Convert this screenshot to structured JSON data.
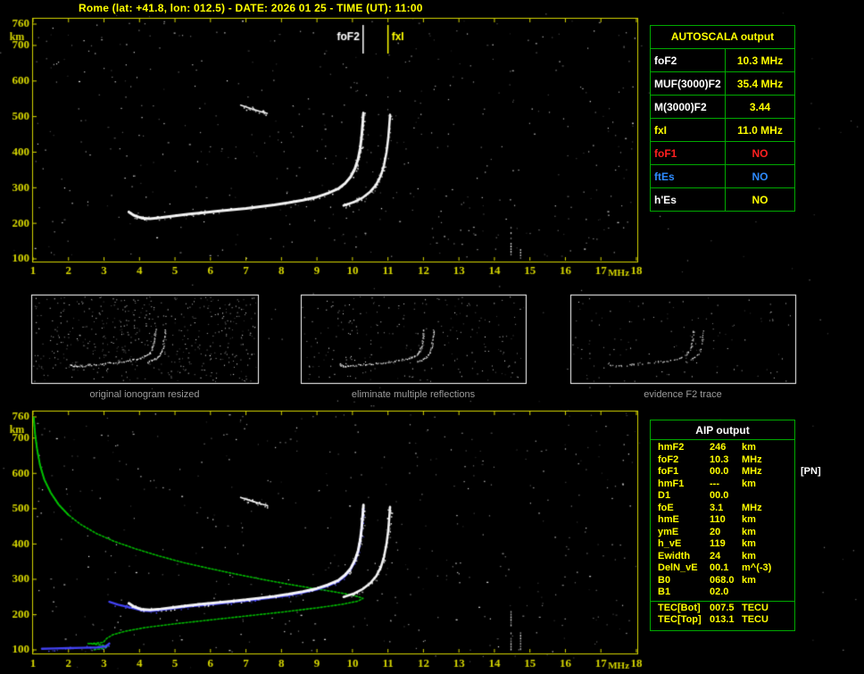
{
  "title": "Rome (lat: +41.8, lon: 012.5) - DATE: 2026 01 25 - TIME (UT): 11:00",
  "colors": {
    "background": "#000000",
    "axis": "#d6d600",
    "trace": "#ffffff",
    "profile": "#00c000",
    "restored": "#4646ff",
    "table_border": "#00aa00",
    "caption": "#9c9c9c"
  },
  "autoscala_table": {
    "header": "AUTOSCALA output",
    "rows": [
      {
        "label": "foF2",
        "value": "10.3 MHz",
        "label_color": "#ffffff",
        "value_color": "#ffff00"
      },
      {
        "label": "MUF(3000)F2",
        "value": "35.4 MHz",
        "label_color": "#ffffff",
        "value_color": "#ffff00"
      },
      {
        "label": "M(3000)F2",
        "value": "3.44",
        "label_color": "#ffffff",
        "value_color": "#ffff00"
      },
      {
        "label": "fxI",
        "value": "11.0 MHz",
        "label_color": "#ffff00",
        "value_color": "#ffff00"
      },
      {
        "label": "foF1",
        "value": "NO",
        "label_color": "#ff2020",
        "value_color": "#ff2020"
      },
      {
        "label": "ftEs",
        "value": "NO",
        "label_color": "#2e8bff",
        "value_color": "#2e8bff"
      },
      {
        "label": "h'Es",
        "value": "NO",
        "label_color": "#ffffff",
        "value_color": "#ffff00"
      }
    ]
  },
  "aip_table": {
    "header": "AIP output",
    "rows": [
      {
        "name": "hmF2",
        "value": "246",
        "unit": "km"
      },
      {
        "name": "foF2",
        "value": "10.3",
        "unit": "MHz"
      },
      {
        "name": "foF1",
        "value": "00.0",
        "unit": "MHz",
        "note": "[PN]"
      },
      {
        "name": "hmF1",
        "value": "---",
        "unit": "km"
      },
      {
        "name": "D1",
        "value": "00.0",
        "unit": ""
      },
      {
        "name": "foE",
        "value": "3.1",
        "unit": "MHz"
      },
      {
        "name": "hmE",
        "value": "110",
        "unit": "km"
      },
      {
        "name": "ymE",
        "value": "20",
        "unit": "km"
      },
      {
        "name": "h_vE",
        "value": "119",
        "unit": "km"
      },
      {
        "name": "Ewidth",
        "value": "24",
        "unit": "km"
      },
      {
        "name": "DelN_vE",
        "value": "00.1",
        "unit": "m^(-3)"
      },
      {
        "name": "B0",
        "value": "068.0",
        "unit": "km"
      },
      {
        "name": "B1",
        "value": "02.0",
        "unit": ""
      }
    ],
    "tec_rows": [
      {
        "name": "TEC[Bot]",
        "value": "007.5",
        "unit": "TECU"
      },
      {
        "name": "TEC[Top]",
        "value": "013.1",
        "unit": "TECU"
      }
    ]
  },
  "thumbnails": [
    {
      "caption": "original ionogram resized",
      "noise": 520
    },
    {
      "caption": "eliminate multiple reflections",
      "noise": 230
    },
    {
      "caption": "evidence F2 trace",
      "noise": 110
    }
  ],
  "chart_data": [
    {
      "type": "scatter",
      "name": "autoscaled ionogram",
      "xlabel": "MHz",
      "ylabel": "km",
      "xlim": [
        1,
        18
      ],
      "ylim": [
        100,
        760
      ],
      "x_ticks": [
        1,
        2,
        3,
        4,
        5,
        6,
        7,
        8,
        9,
        10,
        11,
        12,
        13,
        14,
        15,
        16,
        17,
        18
      ],
      "y_ticks": [
        760,
        700,
        600,
        500,
        400,
        300,
        200,
        100
      ],
      "grid": false,
      "markers": [
        {
          "label": "foF2",
          "x": 10.3,
          "color": "#ffffff",
          "align": "left"
        },
        {
          "label": "fxI",
          "x": 11.0,
          "color": "#ffff00",
          "align": "right"
        }
      ],
      "rfi_lines": [
        {
          "x": 14.45,
          "y": [
            100,
            190
          ]
        },
        {
          "x": 14.72,
          "y": [
            100,
            135
          ]
        }
      ],
      "series": [
        {
          "name": "F2 ordinary trace",
          "color": "#ffffff",
          "width": 3,
          "fuzz": 130,
          "points": [
            [
              3.7,
              232
            ],
            [
              3.85,
              222
            ],
            [
              4.05,
              215
            ],
            [
              4.3,
              213
            ],
            [
              4.6,
              216
            ],
            [
              5.0,
              221
            ],
            [
              5.4,
              226
            ],
            [
              5.8,
              230
            ],
            [
              6.2,
              234
            ],
            [
              6.6,
              238
            ],
            [
              7.0,
              242
            ],
            [
              7.4,
              247
            ],
            [
              7.8,
              252
            ],
            [
              8.2,
              258
            ],
            [
              8.6,
              265
            ],
            [
              9.0,
              274
            ],
            [
              9.3,
              284
            ],
            [
              9.6,
              297
            ],
            [
              9.8,
              313
            ],
            [
              9.95,
              331
            ],
            [
              10.07,
              354
            ],
            [
              10.16,
              381
            ],
            [
              10.22,
              412
            ],
            [
              10.26,
              446
            ],
            [
              10.29,
              482
            ],
            [
              10.31,
              510
            ]
          ]
        },
        {
          "name": "F2 extraordinary trace",
          "color": "#ffffff",
          "width": 2.6,
          "fuzz": 70,
          "points": [
            [
              9.75,
              250
            ],
            [
              10.05,
              260
            ],
            [
              10.3,
              273
            ],
            [
              10.5,
              289
            ],
            [
              10.67,
              309
            ],
            [
              10.8,
              334
            ],
            [
              10.89,
              364
            ],
            [
              10.96,
              400
            ],
            [
              11.01,
              440
            ],
            [
              11.04,
              478
            ],
            [
              11.06,
              505
            ]
          ]
        },
        {
          "name": "second hop echo",
          "color": "#ffffff",
          "width": 1.6,
          "fuzz": 25,
          "points": [
            [
              6.85,
              532
            ],
            [
              7.15,
              522
            ],
            [
              7.45,
              513
            ],
            [
              7.6,
              509
            ]
          ]
        }
      ]
    },
    {
      "type": "scatter",
      "name": "AIP restored trace and electron density profile",
      "xlabel": "MHz",
      "ylabel": "km",
      "xlim": [
        1,
        18
      ],
      "ylim": [
        100,
        760
      ],
      "x_ticks": [
        1,
        2,
        3,
        4,
        5,
        6,
        7,
        8,
        9,
        10,
        11,
        12,
        13,
        14,
        15,
        16,
        17,
        18
      ],
      "y_ticks": [
        760,
        700,
        600,
        500,
        400,
        300,
        200,
        100
      ],
      "grid": false,
      "rfi_lines": [
        {
          "x": 14.45,
          "y": [
            100,
            210
          ]
        },
        {
          "x": 14.72,
          "y": [
            100,
            150
          ]
        }
      ],
      "series": [
        {
          "name": "electron density profile",
          "color": "#00c000",
          "width": 1.6,
          "points": [
            [
              1.02,
              758
            ],
            [
              1.06,
              710
            ],
            [
              1.12,
              665
            ],
            [
              1.2,
              622
            ],
            [
              1.32,
              582
            ],
            [
              1.5,
              545
            ],
            [
              1.72,
              512
            ],
            [
              2.0,
              482
            ],
            [
              2.35,
              455
            ],
            [
              2.78,
              430
            ],
            [
              3.3,
              407
            ],
            [
              3.9,
              386
            ],
            [
              4.55,
              366
            ],
            [
              5.25,
              347
            ],
            [
              6.0,
              330
            ],
            [
              6.75,
              314
            ],
            [
              7.5,
              299
            ],
            [
              8.2,
              286
            ],
            [
              8.85,
              275
            ],
            [
              9.4,
              266
            ],
            [
              9.85,
              258
            ],
            [
              10.15,
              251
            ],
            [
              10.3,
              246
            ],
            [
              10.15,
              238
            ],
            [
              9.7,
              229
            ],
            [
              9.0,
              219
            ],
            [
              8.1,
              208
            ],
            [
              7.1,
              197
            ],
            [
              6.1,
              186
            ],
            [
              5.1,
              175
            ],
            [
              4.2,
              164
            ],
            [
              3.6,
              153
            ],
            [
              3.25,
              143
            ],
            [
              3.08,
              133
            ],
            [
              3.02,
              126
            ],
            [
              2.98,
              121
            ],
            [
              2.75,
              119
            ],
            [
              2.55,
              118
            ],
            [
              2.85,
              115
            ],
            [
              3.05,
              112
            ],
            [
              3.1,
              108
            ],
            [
              2.95,
              104
            ],
            [
              2.7,
              100
            ]
          ]
        },
        {
          "name": "restored F trace",
          "color": "#4646ff",
          "width": 2.4,
          "fuzz": 60,
          "points": [
            [
              3.15,
              236
            ],
            [
              3.4,
              228
            ],
            [
              3.7,
              221
            ],
            [
              4.05,
              212
            ],
            [
              4.3,
              210
            ],
            [
              4.6,
              213
            ],
            [
              5.0,
              218
            ],
            [
              5.4,
              223
            ],
            [
              5.8,
              227
            ],
            [
              6.2,
              231
            ],
            [
              6.6,
              235
            ],
            [
              7.0,
              239
            ],
            [
              7.4,
              244
            ],
            [
              7.8,
              249
            ],
            [
              8.2,
              255
            ],
            [
              8.6,
              262
            ],
            [
              9.0,
              271
            ],
            [
              9.3,
              281
            ],
            [
              9.6,
              294
            ],
            [
              9.8,
              310
            ],
            [
              9.95,
              328
            ],
            [
              10.07,
              351
            ],
            [
              10.16,
              378
            ],
            [
              10.22,
              409
            ],
            [
              10.26,
              443
            ],
            [
              10.29,
              479
            ],
            [
              10.31,
              500
            ]
          ]
        },
        {
          "name": "restored E trace",
          "color": "#4646ff",
          "width": 2.4,
          "fuzz": 20,
          "points": [
            [
              1.25,
              103
            ],
            [
              1.6,
              104
            ],
            [
              2.0,
              105
            ],
            [
              2.4,
              106
            ],
            [
              2.8,
              107
            ],
            [
              3.05,
              110
            ],
            [
              3.15,
              118
            ]
          ]
        },
        {
          "name": "F2 ordinary trace",
          "color": "#ffffff",
          "width": 3,
          "fuzz": 120,
          "points": [
            [
              3.7,
              232
            ],
            [
              3.85,
              222
            ],
            [
              4.05,
              215
            ],
            [
              4.3,
              213
            ],
            [
              4.6,
              216
            ],
            [
              5.0,
              221
            ],
            [
              5.4,
              226
            ],
            [
              5.8,
              230
            ],
            [
              6.2,
              234
            ],
            [
              6.6,
              238
            ],
            [
              7.0,
              242
            ],
            [
              7.4,
              247
            ],
            [
              7.8,
              252
            ],
            [
              8.2,
              258
            ],
            [
              8.6,
              265
            ],
            [
              9.0,
              274
            ],
            [
              9.3,
              284
            ],
            [
              9.6,
              297
            ],
            [
              9.8,
              313
            ],
            [
              9.95,
              331
            ],
            [
              10.07,
              354
            ],
            [
              10.16,
              381
            ],
            [
              10.22,
              412
            ],
            [
              10.26,
              446
            ],
            [
              10.29,
              482
            ],
            [
              10.31,
              510
            ]
          ]
        },
        {
          "name": "F2 extraordinary trace",
          "color": "#ffffff",
          "width": 2.6,
          "fuzz": 60,
          "points": [
            [
              9.75,
              250
            ],
            [
              10.05,
              260
            ],
            [
              10.3,
              273
            ],
            [
              10.5,
              289
            ],
            [
              10.67,
              309
            ],
            [
              10.8,
              334
            ],
            [
              10.89,
              364
            ],
            [
              10.96,
              400
            ],
            [
              11.01,
              440
            ],
            [
              11.04,
              478
            ],
            [
              11.06,
              505
            ]
          ]
        },
        {
          "name": "second hop echo",
          "color": "#ffffff",
          "width": 1.6,
          "fuzz": 20,
          "points": [
            [
              6.85,
              532
            ],
            [
              7.15,
              522
            ],
            [
              7.45,
              513
            ],
            [
              7.6,
              509
            ]
          ]
        }
      ]
    }
  ]
}
